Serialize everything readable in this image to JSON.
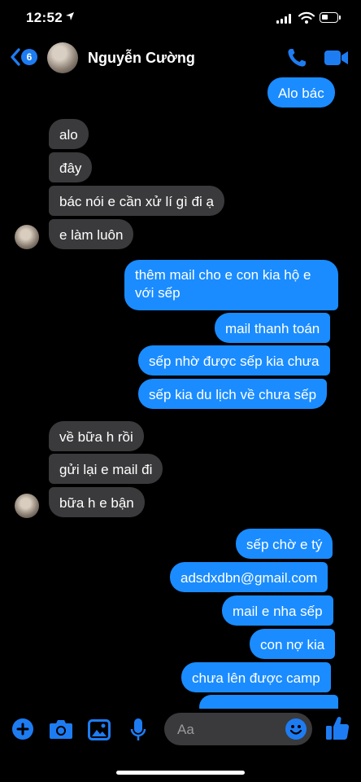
{
  "status": {
    "time": "12:52"
  },
  "header": {
    "badge": "6",
    "contact_name": "Nguyễn Cường"
  },
  "messages": [
    {
      "text": "Alo bác",
      "side": "out"
    },
    {
      "text": "alo",
      "side": "in"
    },
    {
      "text": "đây",
      "side": "in"
    },
    {
      "text": "bác nói e cần xử lí gì đi ạ",
      "side": "in"
    },
    {
      "text": "e làm luôn",
      "side": "in"
    },
    {
      "lines": [
        "thêm mail cho e con kia hộ e",
        "với sếp"
      ],
      "side": "out"
    },
    {
      "text": "mail thanh toán",
      "side": "out"
    },
    {
      "text": "sếp nhờ được sếp kia chưa",
      "side": "out"
    },
    {
      "text": "sếp kia du lịch về chưa sếp",
      "side": "out"
    },
    {
      "text": "về bữa h rồi",
      "side": "in"
    },
    {
      "text": "gửi lại e mail đi",
      "side": "in"
    },
    {
      "text": "bữa h e bận",
      "side": "in"
    },
    {
      "text": "sếp chờ e tý",
      "side": "out"
    },
    {
      "text": "adsdxdbn@gmail.com",
      "side": "out"
    },
    {
      "text": "mail e nha sếp",
      "side": "out"
    },
    {
      "text": "con nợ kia",
      "side": "out"
    },
    {
      "text": "chưa lên được camp",
      "side": "out"
    }
  ],
  "composer": {
    "placeholder": "Aa"
  },
  "colors": {
    "outgoing": "#1a8cff",
    "incoming": "#3a3a3c",
    "accent": "#1e7cf2"
  },
  "icons": [
    "location-arrow-icon",
    "signal-icon",
    "wifi-icon",
    "battery-icon",
    "back-chevron-icon",
    "phone-icon",
    "video-camera-icon",
    "plus-icon",
    "camera-icon",
    "photo-icon",
    "microphone-icon",
    "emoji-icon",
    "thumbs-up-icon"
  ]
}
